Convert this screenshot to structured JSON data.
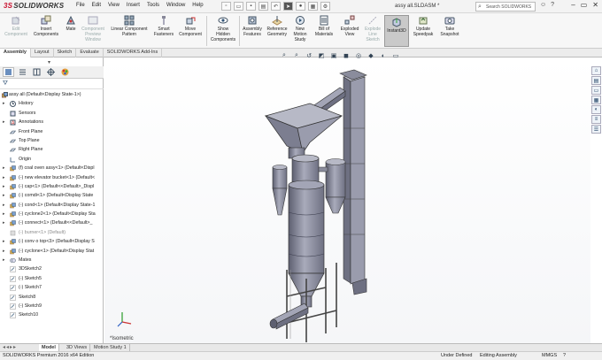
{
  "app": {
    "brand_ds": "3S",
    "brand_name": "SOLIDWORKS",
    "document_title": "assy all.SLDASM *"
  },
  "menu": [
    "File",
    "Edit",
    "View",
    "Insert",
    "Tools",
    "Window",
    "Help"
  ],
  "search": {
    "placeholder": "Search SOLIDWORKS Help"
  },
  "commands": [
    {
      "label1": "Edit",
      "label2": "Component",
      "icon": "edit-component-icon",
      "state": "disabled"
    },
    {
      "label1": "Insert",
      "label2": "Components",
      "icon": "insert-components-icon",
      "state": "normal"
    },
    {
      "label1": "Mate",
      "label2": "",
      "icon": "mate-icon",
      "state": "normal"
    },
    {
      "label1": "Component",
      "label2": "Preview",
      "label3": "Window",
      "icon": "preview-window-icon",
      "state": "disabled"
    },
    {
      "label1": "Linear Component",
      "label2": "Pattern",
      "icon": "linear-pattern-icon",
      "state": "normal"
    },
    {
      "label1": "Smart",
      "label2": "Fasteners",
      "icon": "smart-fasteners-icon",
      "state": "normal"
    },
    {
      "label1": "Move",
      "label2": "Component",
      "icon": "move-component-icon",
      "state": "normal"
    },
    {
      "label1": "Show",
      "label2": "Hidden",
      "label3": "Components",
      "icon": "show-hidden-icon",
      "state": "normal"
    },
    {
      "label1": "Assembly",
      "label2": "Features",
      "icon": "assembly-features-icon",
      "state": "normal"
    },
    {
      "label1": "Reference",
      "label2": "Geometry",
      "icon": "reference-geometry-icon",
      "state": "normal"
    },
    {
      "label1": "New",
      "label2": "Motion",
      "label3": "Study",
      "icon": "motion-study-icon",
      "state": "normal"
    },
    {
      "label1": "Bill of",
      "label2": "Materials",
      "icon": "bom-icon",
      "state": "normal"
    },
    {
      "label1": "Exploded",
      "label2": "View",
      "icon": "exploded-view-icon",
      "state": "normal"
    },
    {
      "label1": "Explode",
      "label2": "Line",
      "label3": "Sketch",
      "icon": "explode-line-icon",
      "state": "disabled"
    },
    {
      "label1": "Instant3D",
      "label2": "",
      "icon": "instant3d-icon",
      "state": "active"
    },
    {
      "label1": "Update",
      "label2": "Speedpak",
      "icon": "speedpak-icon",
      "state": "normal"
    },
    {
      "label1": "Take",
      "label2": "Snapshot",
      "icon": "snapshot-icon",
      "state": "normal"
    }
  ],
  "cmd_tabs": [
    "Assembly",
    "Layout",
    "Sketch",
    "Evaluate",
    "SOLIDWORKS Add-Ins"
  ],
  "tree": {
    "root": "assy all  (Default<Display State-1>)",
    "items": [
      {
        "label": "History",
        "icon": "history-icon",
        "exp": "▸"
      },
      {
        "label": "Sensors",
        "icon": "sensors-icon",
        "exp": ""
      },
      {
        "label": "Annotations",
        "icon": "annotations-icon",
        "exp": "▸"
      },
      {
        "label": "Front Plane",
        "icon": "plane-icon",
        "exp": ""
      },
      {
        "label": "Top Plane",
        "icon": "plane-icon",
        "exp": ""
      },
      {
        "label": "Right Plane",
        "icon": "plane-icon",
        "exp": ""
      },
      {
        "label": "Origin",
        "icon": "origin-icon",
        "exp": ""
      },
      {
        "label": "(f) coal oven assy<1> (Default<Displ",
        "icon": "component-icon",
        "exp": "▸"
      },
      {
        "label": "(-) new elevator bucket<1> (Default<",
        "icon": "component-icon",
        "exp": "▸"
      },
      {
        "label": "(-) cap<1> (Default<<Default>_Displ",
        "icon": "component-icon",
        "exp": "▸"
      },
      {
        "label": "(-) comdi<1> (Default<Display State",
        "icon": "component-icon",
        "exp": "▸"
      },
      {
        "label": "(-) cond<1> (Default<Display State-1",
        "icon": "component-icon",
        "exp": "▸"
      },
      {
        "label": "(-) cyclone2<1> (Default<Display Sta",
        "icon": "component-icon",
        "exp": "▸"
      },
      {
        "label": "(-) connect<1> (Default<<Default>_",
        "icon": "component-icon",
        "exp": "▸"
      },
      {
        "label": "(-) burner<1> (Default)",
        "icon": "component-gray-icon",
        "exp": "",
        "gray": true
      },
      {
        "label": "(-) conv o top<3> (Default<Display S",
        "icon": "component-icon",
        "exp": "▸"
      },
      {
        "label": "(-) cyclone<1> (Default<Display Stat",
        "icon": "component-icon",
        "exp": "▸"
      },
      {
        "label": "Mates",
        "icon": "mates-icon",
        "exp": "▸"
      },
      {
        "label": "3DSketch2",
        "icon": "sketch-icon",
        "exp": ""
      },
      {
        "label": "(-) Sketch5",
        "icon": "sketch-icon",
        "exp": ""
      },
      {
        "label": "(-) Sketch7",
        "icon": "sketch-icon",
        "exp": ""
      },
      {
        "label": "Sketch8",
        "icon": "sketch-icon",
        "exp": ""
      },
      {
        "label": "(-) Sketch9",
        "icon": "sketch-icon",
        "exp": ""
      },
      {
        "label": "Sketch10",
        "icon": "sketch-icon",
        "exp": ""
      }
    ]
  },
  "viewport": {
    "view_label": "*Isometric"
  },
  "bottom_tabs": [
    "Model",
    "3D Views",
    "Motion Study 1"
  ],
  "status": {
    "edition": "SOLIDWORKS Premium 2016 x64 Edition",
    "defined": "Under Defined",
    "editing": "Editing Assembly",
    "units": "MMGS"
  },
  "colors": {
    "accent": "#c8102e",
    "model": "#8a8c9c",
    "model_dark": "#5d5f70",
    "model_light": "#b7b9c6"
  }
}
